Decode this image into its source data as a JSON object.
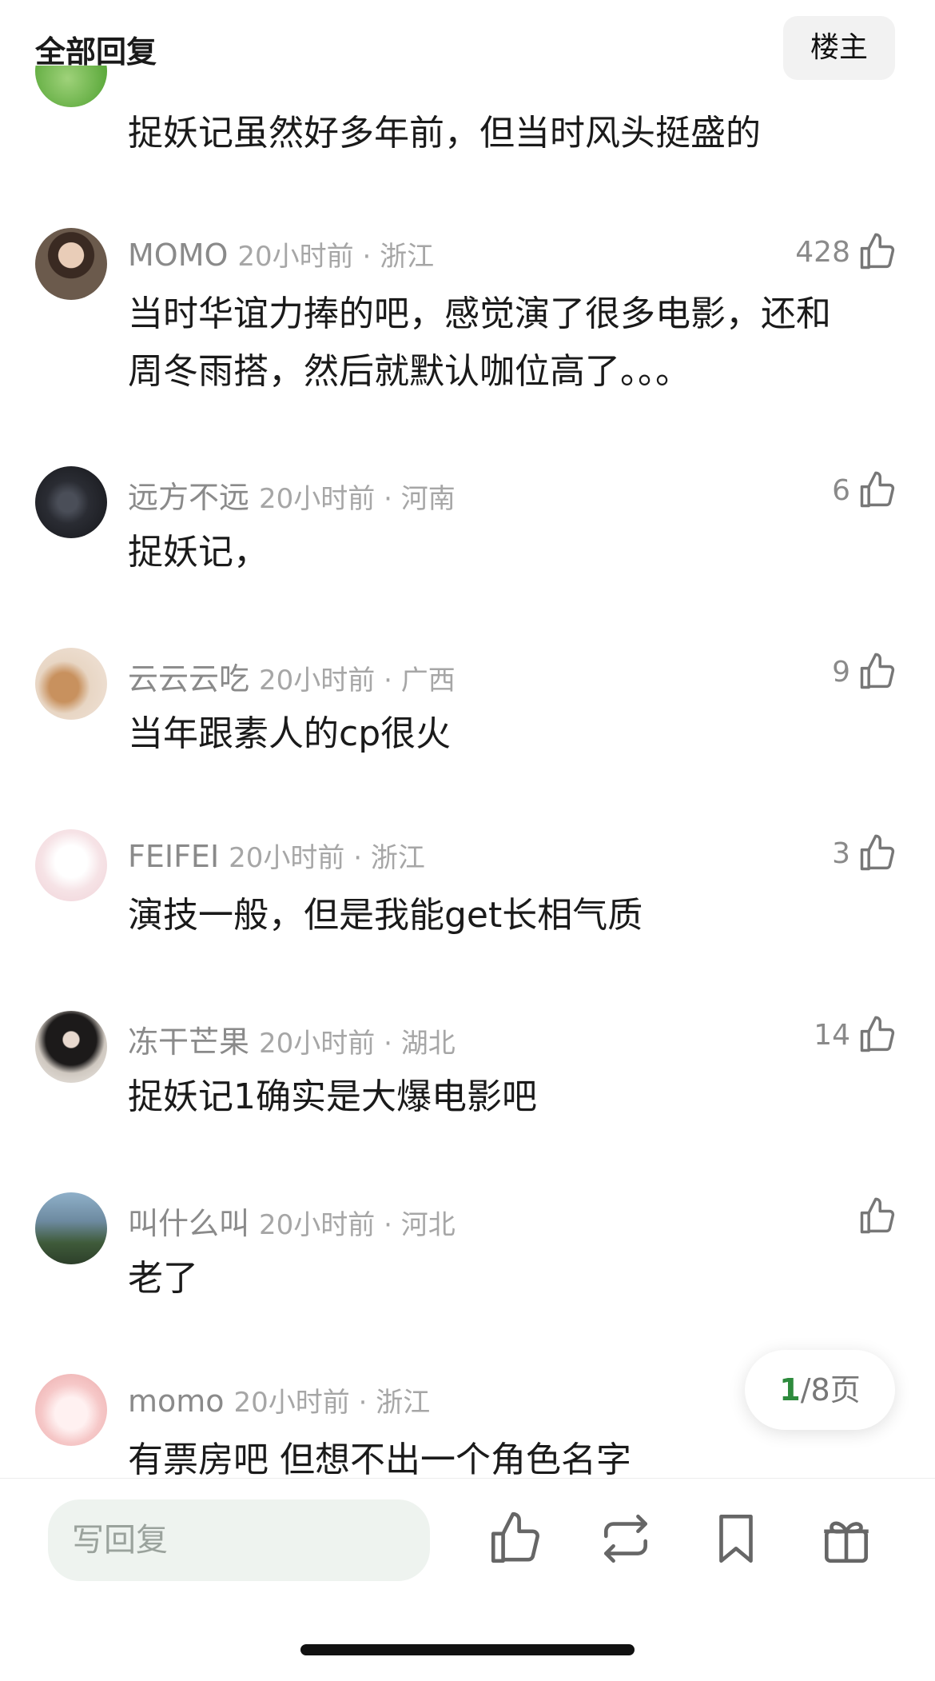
{
  "header": {
    "title": "全部回复",
    "louzhu_label": "楼主"
  },
  "first_comment": {
    "text": "捉妖记虽然好多年前，但当时风头挺盛的"
  },
  "comments": [
    {
      "user": "MOMO",
      "time": "20小时前 · 浙江",
      "likes": "428",
      "text": "当时华谊力捧的吧，感觉演了很多电影，还和周冬雨搭，然后就默认咖位高了。。。"
    },
    {
      "user": "远方不远",
      "time": "20小时前 · 河南",
      "likes": "6",
      "text": "捉妖记，"
    },
    {
      "user": "云云云吃",
      "time": "20小时前 · 广西",
      "likes": "9",
      "text": "当年跟素人的cp很火"
    },
    {
      "user": "FEIFEI",
      "time": "20小时前 · 浙江",
      "likes": "3",
      "text": "演技一般，但是我能get长相气质"
    },
    {
      "user": "冻干芒果",
      "time": "20小时前 · 湖北",
      "likes": "14",
      "text": "捉妖记1确实是大爆电影吧"
    },
    {
      "user": "叫什么叫",
      "time": "20小时前 · 河北",
      "likes": "",
      "text": "老了"
    },
    {
      "user": "momo",
      "time": "20小时前 · 浙江",
      "likes": "",
      "text": "有票房吧 但想不出一个角色名字"
    }
  ],
  "pager": {
    "current": "1",
    "rest": "/8页"
  },
  "bottom_bar": {
    "reply_placeholder": "写回复"
  },
  "icons": {
    "like": "thumbs-up-icon",
    "repost": "repost-icon",
    "bookmark": "bookmark-icon",
    "gift": "gift-icon"
  },
  "colors": {
    "accent": "#2e8b3d",
    "muted_text": "#8a8a8a",
    "input_bg": "#eef3ef"
  }
}
